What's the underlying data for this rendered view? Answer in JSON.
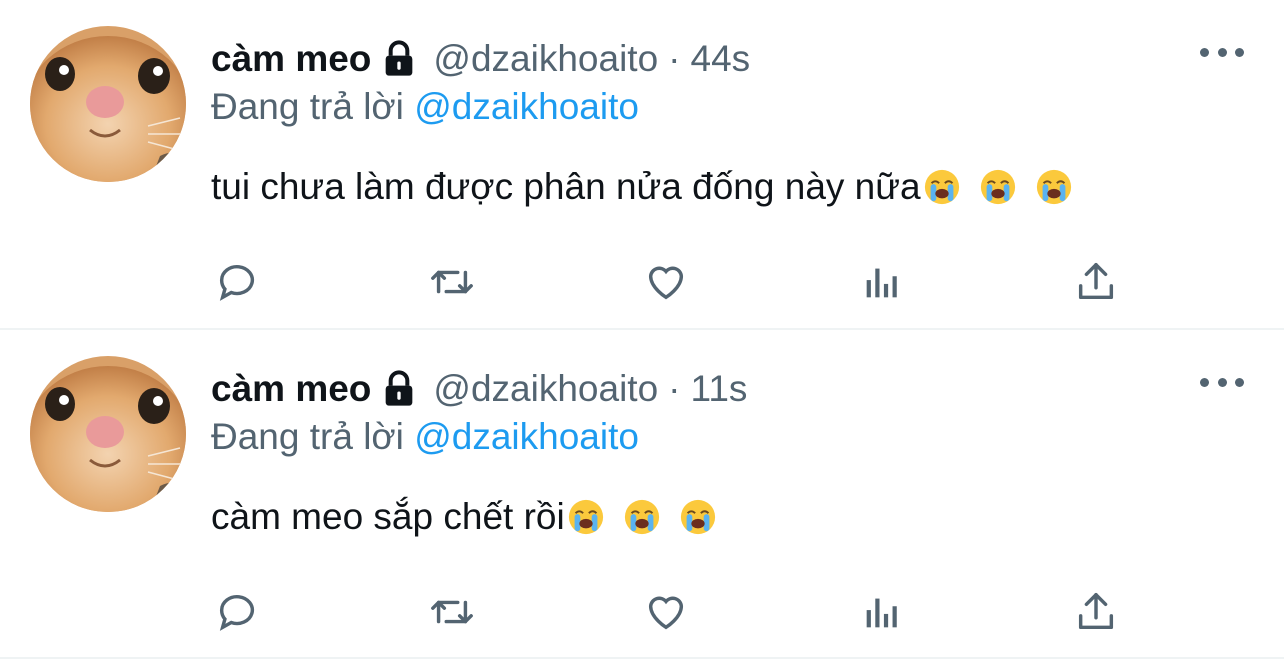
{
  "tweets": [
    {
      "name": "càm meo",
      "handle": "@dzaikhoaito",
      "separator": "·",
      "time": "44s",
      "reply_prefix": "Đang trả lời",
      "reply_mention": "@dzaikhoaito",
      "text": "tui chưa làm được phân nửa đống này nữa",
      "emojis": [
        "loudly-crying-face",
        "loudly-crying-face",
        "loudly-crying-face"
      ]
    },
    {
      "name": "càm meo",
      "handle": "@dzaikhoaito",
      "separator": "·",
      "time": "11s",
      "reply_prefix": "Đang trả lời",
      "reply_mention": "@dzaikhoaito",
      "text": "càm meo sắp chết rồi",
      "emojis": [
        "loudly-crying-face",
        "loudly-crying-face",
        "loudly-crying-face"
      ]
    }
  ],
  "icons": {
    "lock": "lock-icon",
    "more": "more-icon",
    "reply": "reply-icon",
    "retweet": "retweet-icon",
    "like": "like-icon",
    "analytics": "analytics-icon",
    "share": "share-icon"
  },
  "colors": {
    "text_primary": "#0f1419",
    "text_secondary": "#536471",
    "link": "#1d9bf0",
    "divider": "#eff3f4"
  }
}
